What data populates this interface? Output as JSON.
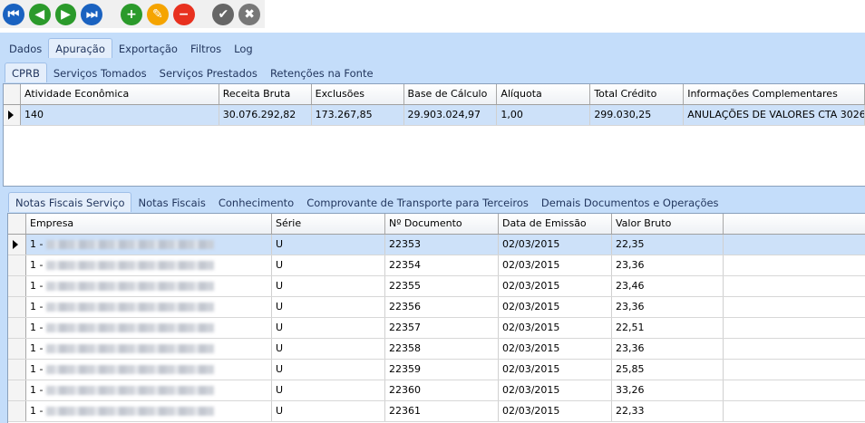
{
  "toolbar": {
    "buttons": [
      {
        "name": "first-record-button",
        "icon": "skip-back-icon",
        "color": "#1a62c0",
        "glyph": "⏮"
      },
      {
        "name": "previous-record-button",
        "icon": "play-left-icon",
        "color": "#2b9a2b",
        "glyph": "◀"
      },
      {
        "name": "next-record-button",
        "icon": "play-right-icon",
        "color": "#2b9a2b",
        "glyph": "▶"
      },
      {
        "name": "last-record-button",
        "icon": "skip-forward-icon",
        "color": "#1a62c0",
        "glyph": "⏭"
      },
      {
        "name": "add-button",
        "icon": "plus-icon",
        "color": "#2b9a2b",
        "glyph": "+"
      },
      {
        "name": "edit-button",
        "icon": "pencil-icon",
        "color": "#f5a400",
        "glyph": "✎"
      },
      {
        "name": "delete-button",
        "icon": "minus-icon",
        "color": "#e8311f",
        "glyph": "−"
      },
      {
        "name": "confirm-button",
        "icon": "check-icon",
        "color": "#666666",
        "glyph": "✔"
      },
      {
        "name": "cancel-button",
        "icon": "close-icon",
        "color": "#777777",
        "glyph": "✖"
      }
    ]
  },
  "main_tabs": [
    "Dados",
    "Apuração",
    "Exportação",
    "Filtros",
    "Log"
  ],
  "main_tab_active": 1,
  "sub_tabs": [
    "CPRB",
    "Serviços Tomados",
    "Serviços Prestados",
    "Retenções na Fonte"
  ],
  "cprb_grid": {
    "columns": [
      "Atividade Econômica",
      "Receita Bruta",
      "Exclusões",
      "Base de Cálculo",
      "Alíquota",
      "Total Crédito",
      "Informações Complementares"
    ],
    "rows": [
      [
        "140",
        "30.076.292,82",
        "173.267,85",
        "29.903.024,97",
        "1,00",
        "299.030,25",
        "ANULAÇÕES DE VALORES CTA 3026"
      ]
    ]
  },
  "doc_tabs": [
    "Notas Fiscais Serviço",
    "Notas Fiscais",
    "Conhecimento",
    "Comprovante de Transporte para Terceiros",
    "Demais Documentos e Operações"
  ],
  "notes_grid": {
    "columns": [
      "Empresa",
      "Série",
      "Nº Documento",
      "Data de Emissão",
      "Valor Bruto"
    ],
    "rows": [
      [
        "1 -",
        "U",
        "22353",
        "02/03/2015",
        "22,35"
      ],
      [
        "1 -",
        "U",
        "22354",
        "02/03/2015",
        "23,36"
      ],
      [
        "1 -",
        "U",
        "22355",
        "02/03/2015",
        "23,46"
      ],
      [
        "1 -",
        "U",
        "22356",
        "02/03/2015",
        "23,36"
      ],
      [
        "1 -",
        "U",
        "22357",
        "02/03/2015",
        "22,51"
      ],
      [
        "1 -",
        "U",
        "22358",
        "02/03/2015",
        "23,36"
      ],
      [
        "1 -",
        "U",
        "22359",
        "02/03/2015",
        "25,85"
      ],
      [
        "1 -",
        "U",
        "22360",
        "02/03/2015",
        "33,26"
      ],
      [
        "1 -",
        "U",
        "22361",
        "02/03/2015",
        "22,33"
      ]
    ]
  }
}
